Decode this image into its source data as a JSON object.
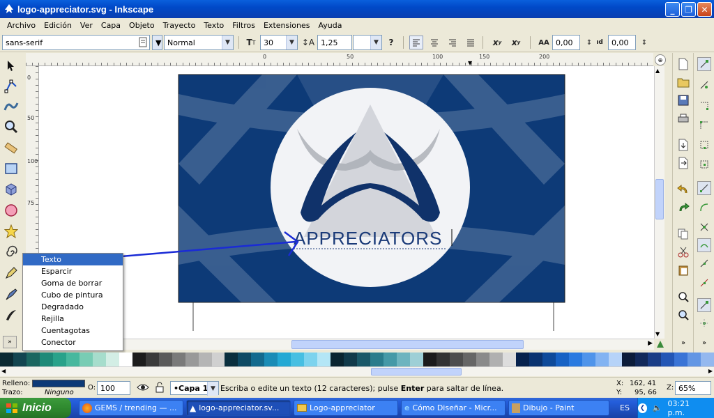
{
  "window": {
    "title": "logo-appreciator.svg - Inkscape"
  },
  "menubar": [
    "Archivo",
    "Edición",
    "Ver",
    "Capa",
    "Objeto",
    "Trayecto",
    "Texto",
    "Filtros",
    "Extensiones",
    "Ayuda"
  ],
  "text_toolbar": {
    "font_family": "sans-serif",
    "font_style": "Normal",
    "font_size": "30",
    "line_spacing": "1,25",
    "letter_spacing": "0,00",
    "word_spacing": "0,00"
  },
  "ruler_labels": {
    "top": [
      "0",
      "50",
      "100",
      "150",
      "200"
    ],
    "left": [
      "0",
      "50",
      "75",
      "100"
    ]
  },
  "canvas": {
    "logo_text": "APPRECIATORS",
    "colors": {
      "background": "#0d3a77",
      "circle": "#f2f3f6",
      "logo": "#10326a",
      "triangle": "#b9bcc4",
      "arrow": "#1a2bd6"
    }
  },
  "popup_menu": {
    "items": [
      "Texto",
      "Esparcir",
      "Goma de borrar",
      "Cubo de pintura",
      "Degradado",
      "Rejilla",
      "Cuentagotas",
      "Conector"
    ],
    "selected_index": 0
  },
  "palette": [
    "#0b2a33",
    "#134550",
    "#1b6660",
    "#1e8a78",
    "#29a28a",
    "#47b89e",
    "#78ccb4",
    "#a6ddcc",
    "#d3eee5",
    "#ffffff",
    "#1d1d1d",
    "#3b3b3b",
    "#5a5a5a",
    "#7a7a7a",
    "#999999",
    "#b5b5b5",
    "#d0d0d0",
    "#0a2f3e",
    "#0e4a64",
    "#136a8e",
    "#1a8cb6",
    "#24a9d4",
    "#47bfe2",
    "#7dd3ee",
    "#b4e6f6",
    "#0a2530",
    "#113a4a",
    "#1a5868",
    "#2a7c8c",
    "#4599a7",
    "#6db4bf",
    "#9ecfd6",
    "#1c1c1c",
    "#333333",
    "#4d4d4d",
    "#666666",
    "#8a8a8a",
    "#b0b0b0",
    "#dddddd",
    "#06214d",
    "#0a3370",
    "#0e4a9a",
    "#1762c4",
    "#2a7ae0",
    "#4f94ea",
    "#82b3f2",
    "#b6d3f8",
    "#0c1c3a",
    "#12295a",
    "#1a3d86",
    "#2356b5",
    "#3a74d6",
    "#6396e4",
    "#94b8ef"
  ],
  "status": {
    "fill_label": "Relleno:",
    "stroke_label": "Trazo:",
    "stroke_value": "Ninguno",
    "fill_color": "#0d3a77",
    "opacity_label": "O:",
    "opacity": "100",
    "layer": "•Capa 1",
    "message_a": "Escriba o edite un texto (12 caracteres); pulse ",
    "message_bold": "Enter",
    "message_b": " para saltar de línea.",
    "x_label": "X:",
    "x_value": "162, 41",
    "y_label": "Y:",
    "y_value": "95, 66",
    "zoom_label": "Z:",
    "zoom": "65%"
  },
  "taskbar": {
    "start": "Inicio",
    "tasks": [
      "GEMS / trending — ...",
      "logo-appreciator.sv...",
      "Logo-appreciator",
      "Cómo Diseñar - Micr...",
      "Dibujo - Paint"
    ],
    "lang": "ES",
    "time": "03:21 p.m."
  }
}
